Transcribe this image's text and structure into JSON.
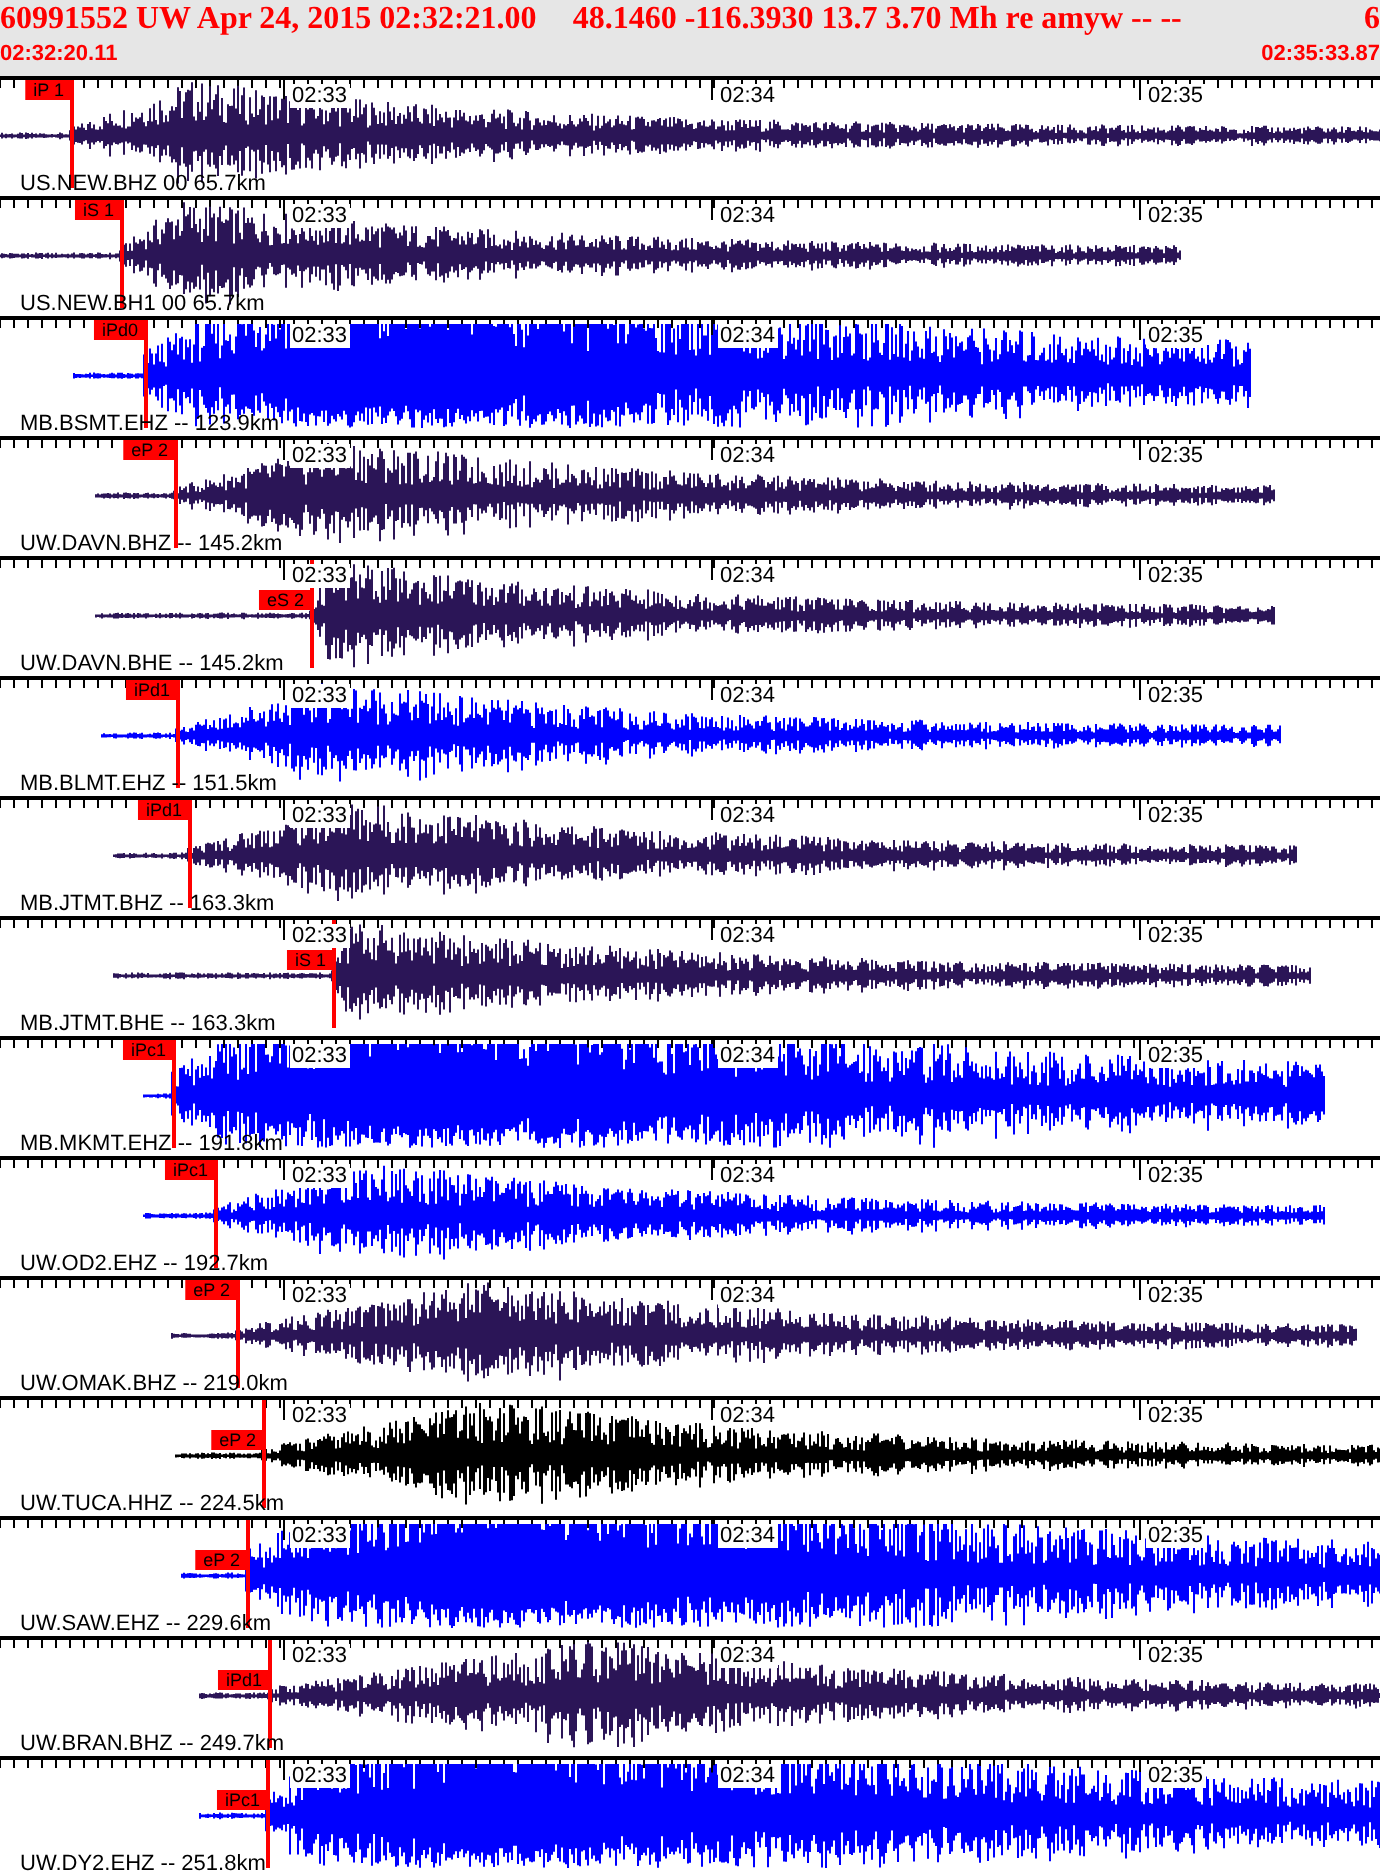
{
  "header": {
    "event": "60991552 UW Apr 24, 2015 02:32:21.00",
    "location": "48.1460 -116.3930 13.7 3.70 Mh re amyw -- --",
    "count": "6",
    "start_time": "02:32:20.11",
    "end_time": "02:35:33.87"
  },
  "traces": [
    {
      "station": "US.NEW.BHZ 00 65.7km",
      "pick": "iP 1",
      "color": "#2b1557",
      "clipped": false,
      "time_labels": [
        "02:33",
        "02:34",
        "02:35"
      ]
    },
    {
      "station": "US.NEW.BH1 00 65.7km",
      "pick": "iS 1",
      "color": "#2b1557",
      "clipped": false,
      "time_labels": [
        "02:33",
        "02:34",
        "02:35"
      ]
    },
    {
      "station": "MB.BSMT.EHZ -- 123.9km",
      "pick": "iPd0",
      "color": "#0000ff",
      "clipped": true,
      "time_labels": [
        "02:33",
        "02:34",
        "02:35"
      ]
    },
    {
      "station": "UW.DAVN.BHZ -- 145.2km",
      "pick": "eP 2",
      "color": "#2b1557",
      "clipped": false,
      "time_labels": [
        "02:33",
        "02:34",
        "02:35"
      ]
    },
    {
      "station": "UW.DAVN.BHE -- 145.2km",
      "pick": "eS 2",
      "color": "#2b1557",
      "clipped": false,
      "time_labels": [
        "02:33",
        "02:34",
        "02:35"
      ]
    },
    {
      "station": "MB.BLMT.EHZ -- 151.5km",
      "pick": "iPd1",
      "color": "#0000ff",
      "clipped": false,
      "time_labels": [
        "02:33",
        "02:34",
        "02:35"
      ]
    },
    {
      "station": "MB.JTMT.BHZ -- 163.3km",
      "pick": "iPd1",
      "color": "#2b1557",
      "clipped": false,
      "time_labels": [
        "02:33",
        "02:34",
        "02:35"
      ]
    },
    {
      "station": "MB.JTMT.BHE -- 163.3km",
      "pick": "iS 1",
      "color": "#2b1557",
      "clipped": false,
      "time_labels": [
        "02:33",
        "02:34",
        "02:35"
      ]
    },
    {
      "station": "MB.MKMT.EHZ -- 191.8km",
      "pick": "iPc1",
      "color": "#0000ff",
      "clipped": true,
      "time_labels": [
        "02:33",
        "02:34",
        "02:35"
      ]
    },
    {
      "station": "UW.OD2.EHZ -- 192.7km",
      "pick": "iPc1",
      "color": "#0000ff",
      "clipped": false,
      "time_labels": [
        "02:33",
        "02:34",
        "02:35"
      ]
    },
    {
      "station": "UW.OMAK.BHZ -- 219.0km",
      "pick": "eP 2",
      "color": "#2b1557",
      "clipped": false,
      "time_labels": [
        "02:33",
        "02:34",
        "02:35"
      ]
    },
    {
      "station": "UW.TUCA.HHZ -- 224.5km",
      "pick": "eP 2",
      "color": "#000000",
      "clipped": false,
      "time_labels": [
        "02:33",
        "02:34",
        "02:35"
      ]
    },
    {
      "station": "UW.SAW.EHZ -- 229.6km",
      "pick": "eP 2",
      "color": "#0000ff",
      "clipped": true,
      "time_labels": [
        "02:33",
        "02:34",
        "02:35"
      ]
    },
    {
      "station": "UW.BRAN.BHZ -- 249.7km",
      "pick": "iPd1",
      "color": "#2b1557",
      "clipped": false,
      "time_labels": [
        "02:33",
        "02:34",
        "02:35"
      ]
    },
    {
      "station": "UW.DY2.EHZ -- 251.8km",
      "pick": "iPc1",
      "color": "#0000ff",
      "clipped": true,
      "time_labels": [
        "02:33",
        "02:34",
        "02:35"
      ]
    }
  ]
}
